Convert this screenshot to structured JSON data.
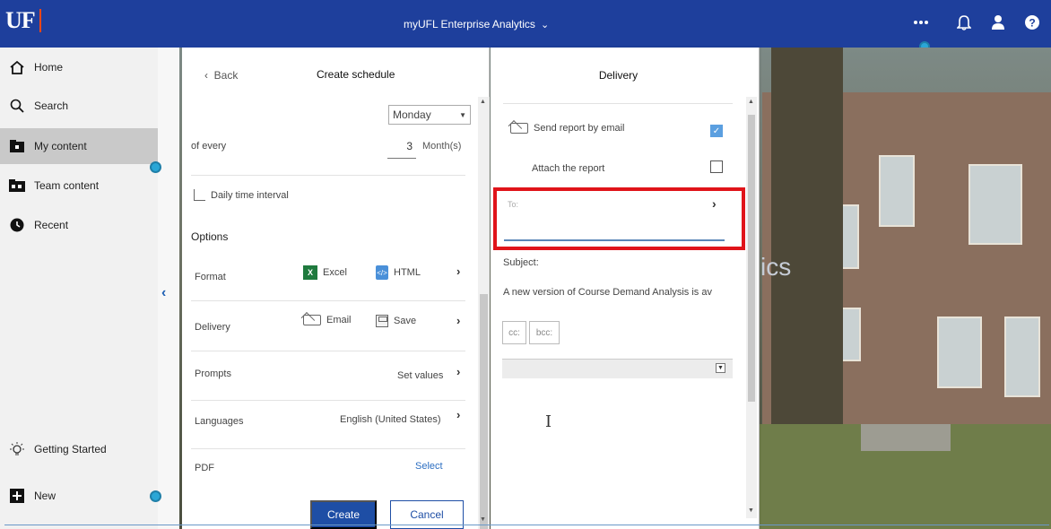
{
  "topbar": {
    "logo": "UF",
    "app_title": "myUFL Enterprise Analytics",
    "icons": [
      "more-icon",
      "bell-icon",
      "user-icon",
      "help-icon"
    ]
  },
  "leftnav": {
    "items": [
      {
        "label": "Home",
        "icon": "home-icon"
      },
      {
        "label": "Search",
        "icon": "search-icon"
      },
      {
        "label": "My content",
        "icon": "my-content-icon"
      },
      {
        "label": "Team content",
        "icon": "team-content-icon"
      },
      {
        "label": "Recent",
        "icon": "recent-icon"
      }
    ],
    "getting_started": "Getting Started",
    "new": "New"
  },
  "background": {
    "text_fragment": "ics"
  },
  "schedule": {
    "back": "Back",
    "title": "Create schedule",
    "day_select": "Monday",
    "of_every": "of every",
    "count": "3",
    "unit": "Month(s)",
    "daily_interval": "Daily time interval",
    "options": "Options",
    "format_label": "Format",
    "format_excel": "Excel",
    "format_html": "HTML",
    "delivery_label": "Delivery",
    "delivery_email": "Email",
    "delivery_save": "Save",
    "prompts_label": "Prompts",
    "prompts_value": "Set values",
    "languages_label": "Languages",
    "languages_value": "English (United States)",
    "pdf_label": "PDF",
    "pdf_select": "Select",
    "create": "Create",
    "cancel": "Cancel"
  },
  "delivery": {
    "title": "Delivery",
    "send_email": "Send report by email",
    "send_email_checked": true,
    "attach_report": "Attach the report",
    "attach_checked": false,
    "to_label": "To:",
    "subject_label": "Subject:",
    "subject_value": "A new version of Course Demand Analysis is av",
    "cc": "cc:",
    "bcc": "bcc:"
  },
  "colors": {
    "topbar": "#1e3f9c",
    "accent_blue": "#1e4ea5",
    "highlight_red": "#e0141a",
    "marker_cyan": "#2aa6d6"
  }
}
